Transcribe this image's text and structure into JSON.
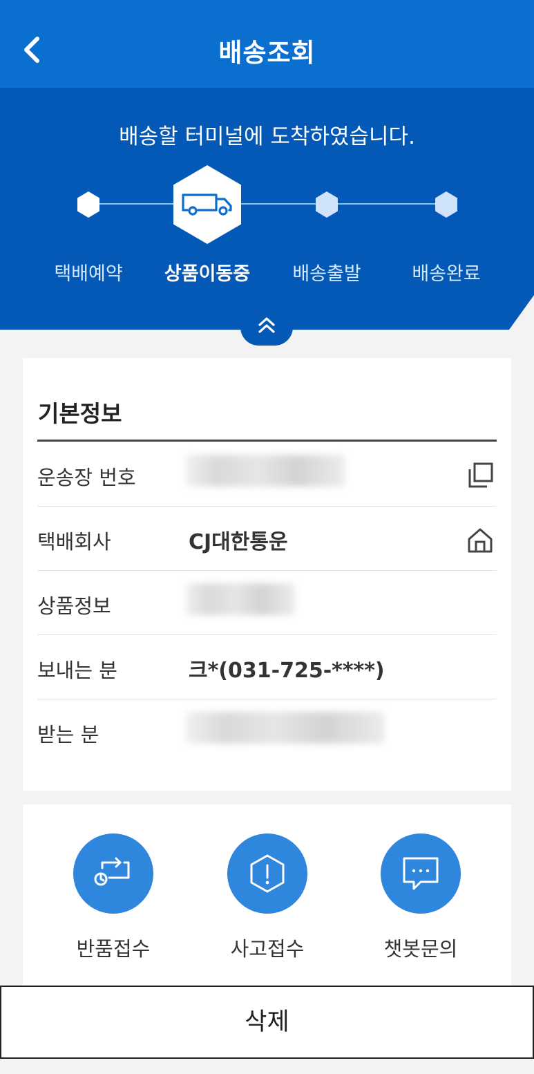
{
  "header": {
    "title": "배송조회",
    "back_icon": "chevron-left-icon"
  },
  "tracking": {
    "status_message": "배송할 터미널에 도착하였습니다.",
    "current_step": 2,
    "steps": [
      {
        "label": "택배예약",
        "state": "done"
      },
      {
        "label": "상품이동중",
        "state": "current",
        "icon": "truck-icon"
      },
      {
        "label": "배송출발",
        "state": "pending"
      },
      {
        "label": "배송완료",
        "state": "pending"
      }
    ],
    "collapse_icon": "double-chevron-up-icon"
  },
  "basic_info": {
    "title": "기본정보",
    "rows": [
      {
        "label": "운송장 번호",
        "value": "",
        "redacted": true,
        "icon": "copy-icon"
      },
      {
        "label": "택배회사",
        "value": "CJ대한통운",
        "icon": "home-icon"
      },
      {
        "label": "상품정보",
        "value": "",
        "redacted": true
      },
      {
        "label": "보내는 분",
        "value": "크*(031-725-****)"
      },
      {
        "label": "받는 분",
        "value": "",
        "redacted": true
      }
    ]
  },
  "actions": [
    {
      "label": "반품접수",
      "icon": "return-clock-icon"
    },
    {
      "label": "사고접수",
      "icon": "hexagon-alert-icon"
    },
    {
      "label": "챗봇문의",
      "icon": "chat-bubble-icon"
    }
  ],
  "footer": {
    "delete_label": "삭제"
  },
  "colors": {
    "appbar": "#0a6fcf",
    "hero": "#0459b6",
    "accent": "#2f86dd",
    "pending_step": "#cfe4fb"
  }
}
